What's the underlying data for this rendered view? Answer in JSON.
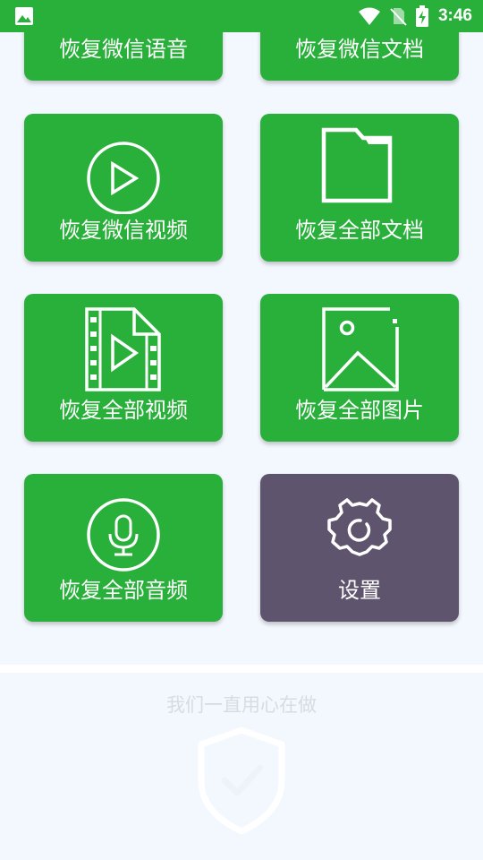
{
  "status_bar": {
    "time": "3:46",
    "icons": [
      "gallery-icon",
      "wifi-icon",
      "no-sim-icon",
      "battery-charging-icon"
    ]
  },
  "cards": [
    {
      "label": "恢复微信语音",
      "icon": "microphone-icon"
    },
    {
      "label": "恢复微信文档",
      "icon": "document-icon"
    },
    {
      "label": "恢复微信视频",
      "icon": "play-circle-icon"
    },
    {
      "label": "恢复全部文档",
      "icon": "folder-icon"
    },
    {
      "label": "恢复全部视频",
      "icon": "video-file-icon"
    },
    {
      "label": "恢复全部图片",
      "icon": "image-icon"
    },
    {
      "label": "恢复全部音频",
      "icon": "microphone-icon"
    },
    {
      "label": "设置",
      "icon": "gear-icon"
    }
  ],
  "footer": {
    "slogan": "我们一直用心在做",
    "icon": "shield-check-icon"
  },
  "colors": {
    "primary_green": "#28b03a",
    "settings_card": "#5f546e",
    "background": "#f3f8fe",
    "footer_text": "#d7dbe2"
  }
}
